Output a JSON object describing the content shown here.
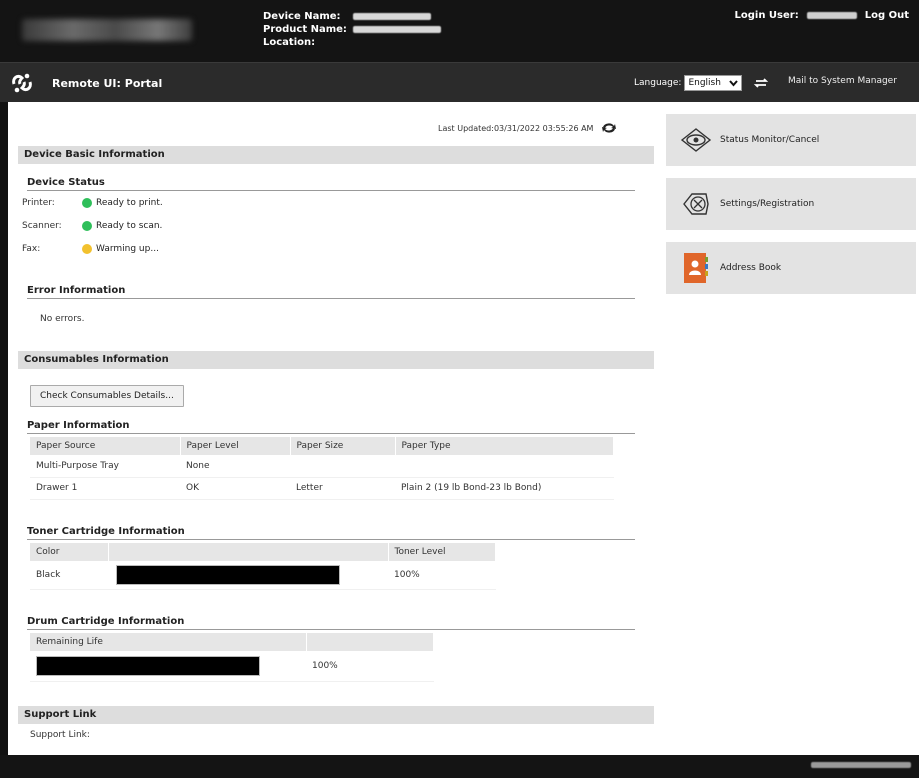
{
  "header": {
    "device_name_label": "Device Name:",
    "product_name_label": "Product Name:",
    "location_label": "Location:",
    "login_user_label": "Login User:",
    "logout_label": "Log Out"
  },
  "portal": {
    "title": "Remote UI: Portal",
    "language_label": "Language:",
    "language_value": "English",
    "mail_link": "Mail to System Manager"
  },
  "main": {
    "last_updated": "Last Updated:03/31/2022 03:55:26 AM",
    "device_basic_info": {
      "heading": "Device Basic Information",
      "device_status_heading": "Device Status",
      "statuses": [
        {
          "key": "Printer:",
          "value": "Ready to print.",
          "color": "#2fbf5a"
        },
        {
          "key": "Scanner:",
          "value": "Ready to scan.",
          "color": "#2fbf5a"
        },
        {
          "key": "Fax:",
          "value": "Warming up...",
          "color": "#f2c12e"
        }
      ],
      "error_heading": "Error Information",
      "error_text": "No errors."
    },
    "consumables": {
      "heading": "Consumables Information",
      "check_button": "Check Consumables Details...",
      "paper": {
        "heading": "Paper Information",
        "columns": [
          "Paper Source",
          "Paper Level",
          "Paper Size",
          "Paper Type"
        ],
        "rows": [
          [
            "Multi-Purpose Tray",
            "None",
            "",
            ""
          ],
          [
            "Drawer 1",
            "OK",
            "Letter",
            "Plain 2 (19 lb Bond-23 lb Bond)"
          ]
        ]
      },
      "toner": {
        "heading": "Toner Cartridge Information",
        "columns": [
          "Color",
          "",
          "Toner Level"
        ],
        "color": "Black",
        "level": "100%",
        "level_fraction": 1.0
      },
      "drum": {
        "heading": "Drum Cartridge Information",
        "column": "Remaining Life",
        "level": "100%",
        "level_fraction": 1.0
      }
    },
    "support": {
      "heading": "Support Link",
      "label": "Support Link:"
    }
  },
  "sidebar": {
    "items": [
      {
        "label": "Status Monitor/Cancel",
        "icon": "eye-icon"
      },
      {
        "label": "Settings/Registration",
        "icon": "settings-icon"
      },
      {
        "label": "Address Book",
        "icon": "address-book-icon"
      }
    ]
  }
}
